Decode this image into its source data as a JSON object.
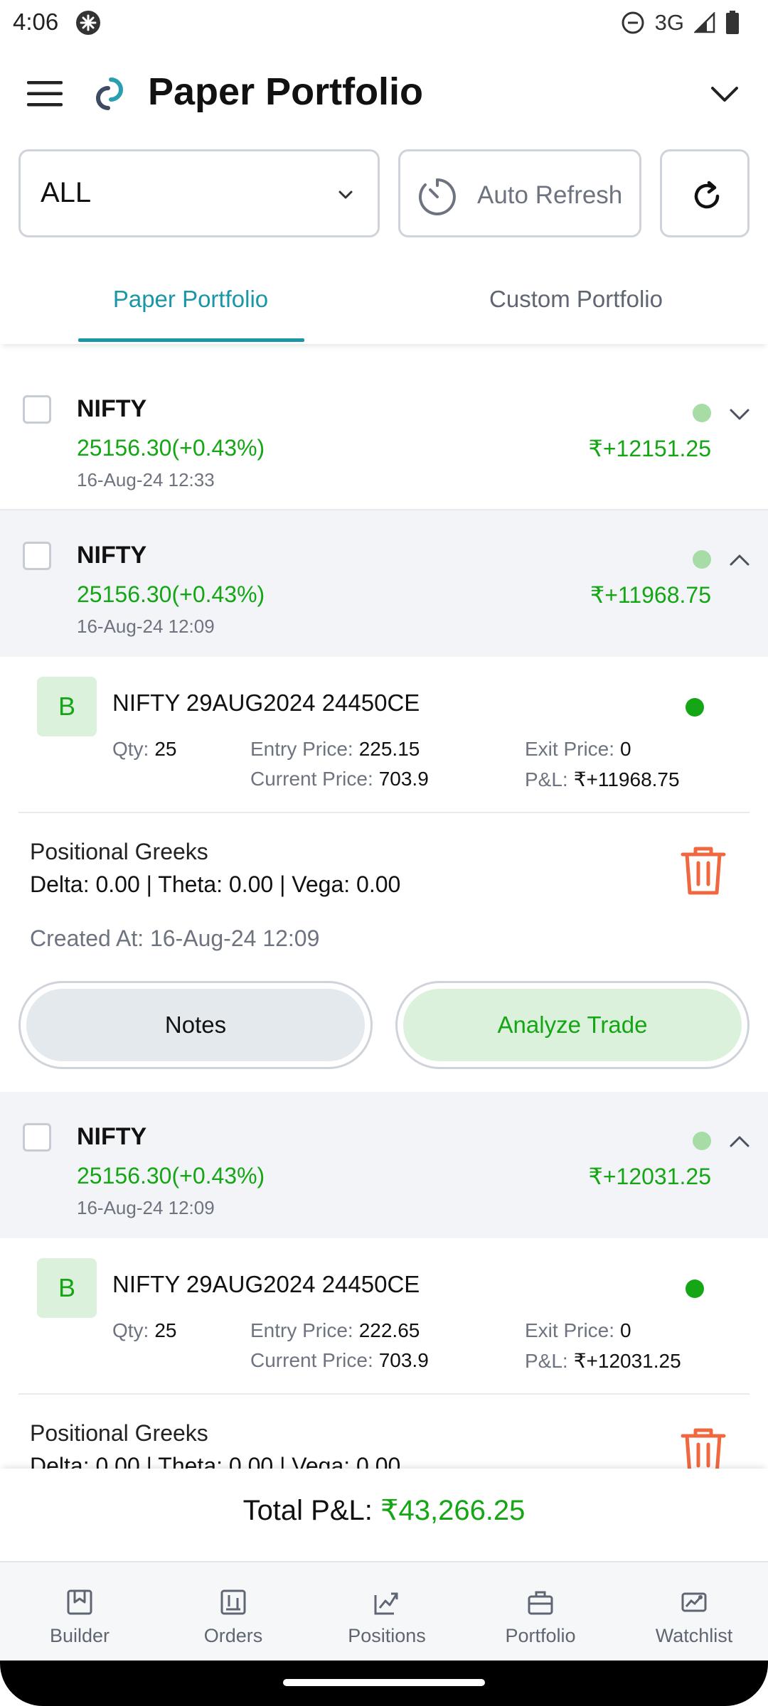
{
  "status_bar": {
    "time": "4:06",
    "network": "3G"
  },
  "header": {
    "title": "Paper Portfolio"
  },
  "filters": {
    "select_value": "ALL",
    "auto_refresh_label": "Auto Refresh"
  },
  "tabs": [
    {
      "label": "Paper Portfolio",
      "active": true
    },
    {
      "label": "Custom Portfolio",
      "active": false
    }
  ],
  "groups": [
    {
      "symbol": "NIFTY",
      "price_change": "25156.30(+0.43%)",
      "date": "16-Aug-24 12:33",
      "pnl": "₹+12151.25",
      "expanded": false
    },
    {
      "symbol": "NIFTY",
      "price_change": "25156.30(+0.43%)",
      "date": "16-Aug-24 12:09",
      "pnl": "₹+11968.75",
      "expanded": true,
      "leg": {
        "side": "B",
        "name": "NIFTY 29AUG2024 24450CE",
        "qty_label": "Qty:",
        "qty": "25",
        "entry_label": "Entry Price:",
        "entry": "225.15",
        "current_label": "Current  Price:",
        "current": "703.9",
        "exit_label": "Exit Price:",
        "exit": "0",
        "pnl_label": "P&L:",
        "pnl": "₹+11968.75"
      },
      "greeks_title": "Positional Greeks",
      "greeks_values": "Delta: 0.00 | Theta: 0.00 | Vega: 0.00",
      "created": "Created At: 16-Aug-24 12:09",
      "notes_label": "Notes",
      "analyze_label": "Analyze Trade"
    },
    {
      "symbol": "NIFTY",
      "price_change": "25156.30(+0.43%)",
      "date": "16-Aug-24 12:09",
      "pnl": "₹+12031.25",
      "expanded": true,
      "leg": {
        "side": "B",
        "name": "NIFTY 29AUG2024 24450CE",
        "qty_label": "Qty:",
        "qty": "25",
        "entry_label": "Entry Price:",
        "entry": "222.65",
        "current_label": "Current  Price:",
        "current": "703.9",
        "exit_label": "Exit Price:",
        "exit": "0",
        "pnl_label": "P&L:",
        "pnl": "₹+12031.25"
      },
      "greeks_title": "Positional Greeks",
      "greeks_values": "Delta: 0.00 | Theta: 0.00 | Vega: 0.00"
    }
  ],
  "total": {
    "label": "Total P&L:",
    "value": "₹43,266.25"
  },
  "bottom_nav": [
    {
      "label": "Builder",
      "icon": "builder-icon"
    },
    {
      "label": "Orders",
      "icon": "orders-icon"
    },
    {
      "label": "Positions",
      "icon": "positions-icon"
    },
    {
      "label": "Portfolio",
      "icon": "portfolio-icon"
    },
    {
      "label": "Watchlist",
      "icon": "watchlist-icon"
    }
  ],
  "colors": {
    "accent": "#1a97a6",
    "profit": "#14a614",
    "danger": "#f0683f"
  }
}
